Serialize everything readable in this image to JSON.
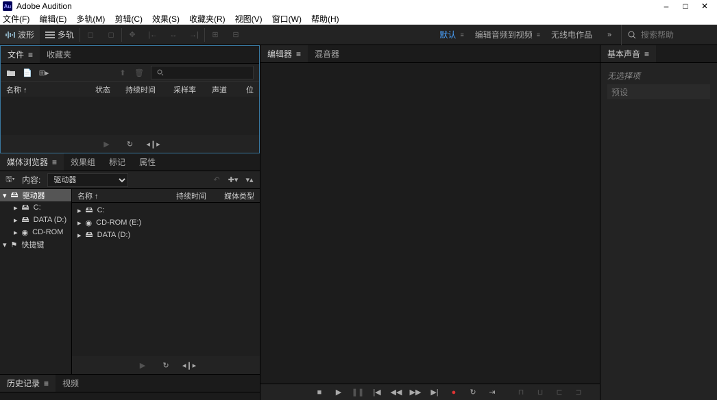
{
  "app": {
    "title": "Adobe Audition",
    "logo": "Au"
  },
  "menubar": [
    "文件(F)",
    "编辑(E)",
    "多轨(M)",
    "剪辑(C)",
    "效果(S)",
    "收藏夹(R)",
    "视图(V)",
    "窗口(W)",
    "帮助(H)"
  ],
  "toolbar": {
    "waveform_label": "波形",
    "multitrack_label": "多轨"
  },
  "workspaces": {
    "items": [
      "默认",
      "编辑音频到视频",
      "无线电作品"
    ],
    "active_index": 0,
    "search_placeholder": "搜索帮助"
  },
  "panels": {
    "files": {
      "tab_file": "文件",
      "tab_fav": "收藏夹",
      "cols": {
        "name": "名称 ↑",
        "status": "状态",
        "duration": "持续时间",
        "samplerate": "采样率",
        "channels": "声道",
        "pos": "位"
      }
    },
    "media": {
      "tabs": [
        "媒体浏览器",
        "效果组",
        "标记",
        "属性"
      ],
      "content_label": "内容:",
      "content_value": "驱动器",
      "tree": {
        "drives": "驱动器",
        "c": "C:",
        "d": "DATA (D:)",
        "cd": "CD-ROM",
        "shortcuts": "快捷键"
      },
      "list_hdr": {
        "name": "名称 ↑",
        "duration": "持续时间",
        "type": "媒体类型"
      },
      "list": [
        "C:",
        "CD-ROM (E:)",
        "DATA (D:)"
      ]
    },
    "editor": {
      "tab_editor": "编辑器",
      "tab_mixer": "混音器"
    },
    "history": {
      "tab_history": "历史记录",
      "tab_video": "视频"
    },
    "basicsound": {
      "title": "基本声音",
      "empty": "无选择项",
      "preset": "预设"
    }
  },
  "icons": {
    "waveform": "waveform-icon",
    "multitrack": "multitrack-icon",
    "search": "search-icon",
    "play": "play-icon",
    "loop": "loop-icon",
    "speaker": "speaker-icon",
    "folder": "folder-icon",
    "drive": "drive-icon",
    "chevron": "chevron-icon",
    "filter": "filter-icon",
    "plus": "plus-icon",
    "back": "back-icon",
    "stop": "stop-icon",
    "record": "record-icon",
    "skip_prev": "skip-prev-icon",
    "skip_next": "skip-next-icon",
    "rewind": "rewind-icon",
    "forward": "forward-icon",
    "end": "end-icon",
    "min": "minimize-icon",
    "max": "maximize-icon",
    "close": "close-icon",
    "more": "more-icon"
  }
}
